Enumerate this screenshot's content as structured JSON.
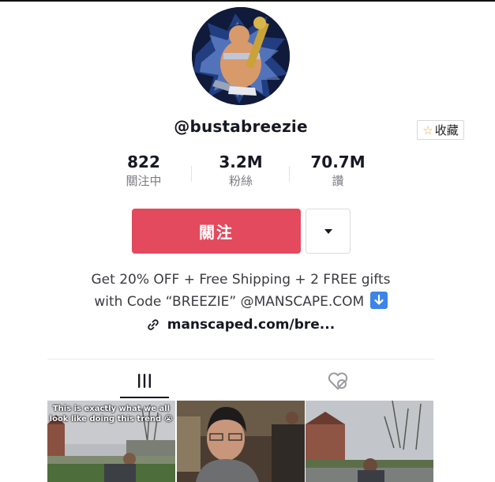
{
  "profile": {
    "username": "@bustabreezie",
    "favorite_label": "收藏"
  },
  "stats": [
    {
      "value": "822",
      "label": "關注中"
    },
    {
      "value": "3.2M",
      "label": "粉絲"
    },
    {
      "value": "70.7M",
      "label": "讚"
    }
  ],
  "actions": {
    "follow_label": "關注"
  },
  "bio": {
    "line1": "Get 20% OFF + Free Shipping + 2 FREE gifts",
    "line2": "with Code “BREEZIE” @MANSCAPE.COM",
    "link": "manscaped.com/bre..."
  },
  "tabs": [
    {
      "icon": "videos-grid-icon",
      "selected": true
    },
    {
      "icon": "liked-hidden-icon",
      "selected": false
    }
  ],
  "videos": [
    {
      "caption": "This is exactly what we all look like doing this trend 😭"
    },
    {
      "caption": ""
    },
    {
      "caption": ""
    }
  ],
  "colors": {
    "accent": "#e34a5e",
    "text": "#161823",
    "secondary": "#7b7c82"
  }
}
